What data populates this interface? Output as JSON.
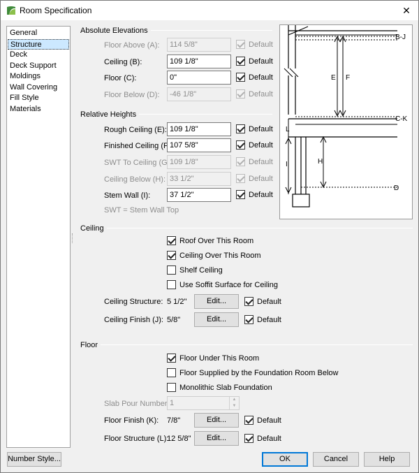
{
  "window": {
    "title": "Room Specification",
    "close_glyph": "✕"
  },
  "nav": {
    "items": [
      "General",
      "Structure",
      "Deck",
      "Deck Support",
      "Moldings",
      "Wall Covering",
      "Fill Style",
      "Materials"
    ],
    "selected": "Structure"
  },
  "absolute": {
    "title": "Absolute Elevations",
    "rows": [
      {
        "label": "Floor Above (A):",
        "value": "114 5/8\"",
        "default_label": "Default",
        "enabled": false
      },
      {
        "label": "Ceiling (B):",
        "value": "109 1/8\"",
        "default_label": "Default",
        "enabled": true
      },
      {
        "label": "Floor (C):",
        "value": "0\"",
        "default_label": "Default",
        "enabled": true
      },
      {
        "label": "Floor Below (D):",
        "value": "-46 1/8\"",
        "default_label": "Default",
        "enabled": false
      }
    ]
  },
  "relative": {
    "title": "Relative Heights",
    "rows": [
      {
        "label": "Rough Ceiling (E):",
        "value": "109 1/8\"",
        "default_label": "Default",
        "enabled": true
      },
      {
        "label": "Finished Ceiling (F):",
        "value": "107 5/8\"",
        "default_label": "Default",
        "enabled": true
      },
      {
        "label": "SWT To Ceiling (G):",
        "value": "109 1/8\"",
        "default_label": "Default",
        "enabled": false
      },
      {
        "label": "Ceiling Below (H):",
        "value": "33 1/2\"",
        "default_label": "Default",
        "enabled": false
      },
      {
        "label": "Stem Wall (I):",
        "value": "37 1/2\"",
        "default_label": "Default",
        "enabled": true
      }
    ],
    "note": "SWT = Stem Wall Top"
  },
  "diagram": {
    "labels": {
      "b_j": "B-J",
      "c_k": "C-K",
      "d": "D",
      "e": "E",
      "f": "F",
      "h": "H",
      "i": "I",
      "l": "L"
    }
  },
  "ceiling": {
    "title": "Ceiling",
    "roof_over": "Roof Over This Room",
    "ceiling_over": "Ceiling Over This Room",
    "shelf": "Shelf Ceiling",
    "soffit": "Use Soffit Surface for Ceiling",
    "structure_label": "Ceiling Structure:",
    "structure_value": "5 1/2\"",
    "finish_label": "Ceiling Finish (J):",
    "finish_value": "5/8\"",
    "edit_label": "Edit...",
    "default_label": "Default"
  },
  "floor": {
    "title": "Floor",
    "under": "Floor Under This Room",
    "supplied": "Floor Supplied by the Foundation Room Below",
    "monolithic": "Monolithic Slab Foundation",
    "slab_label": "Slab Pour Number:",
    "slab_value": "1",
    "finish_label": "Floor Finish (K):",
    "finish_value": "7/8\"",
    "structure_label": "Floor Structure (L):",
    "structure_value": "12 5/8\"",
    "edit_label": "Edit...",
    "default_label": "Default"
  },
  "footer": {
    "number_style": "Number Style...",
    "ok": "OK",
    "cancel": "Cancel",
    "help": "Help"
  }
}
